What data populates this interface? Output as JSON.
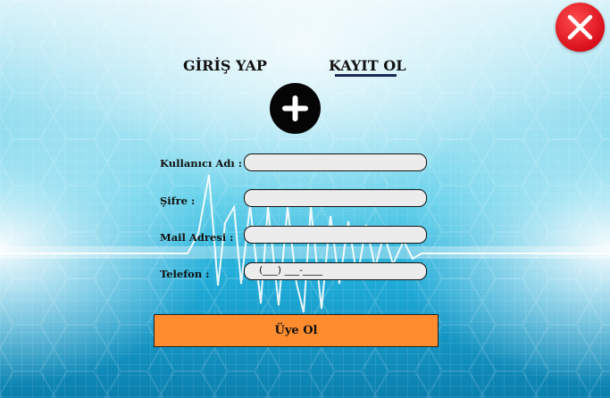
{
  "colors": {
    "background_top": "#dff5fb",
    "background_mid": "#36c4e6",
    "background_bottom": "#0a8ab8",
    "close_button": "#e01b24",
    "submit_button": "#ff8c2e",
    "tab_underline": "#1a2a55",
    "field_background": "#ececec"
  },
  "window": {
    "close_icon": "close-icon"
  },
  "tabs": [
    {
      "label": "GİRİŞ YAP",
      "active": false
    },
    {
      "label": "KAYIT OL",
      "active": true
    }
  ],
  "profile": {
    "icon": "plus-icon"
  },
  "form": {
    "username_label": "Kullanıcı Adı :",
    "username_value": "",
    "password_label": "Şifre :",
    "password_value": "",
    "email_label": "Mail Adresi :",
    "email_value": "",
    "phone_label": "Telefon :",
    "phone_mask": "(___) ___-____",
    "submit_label": "Üye Ol"
  }
}
